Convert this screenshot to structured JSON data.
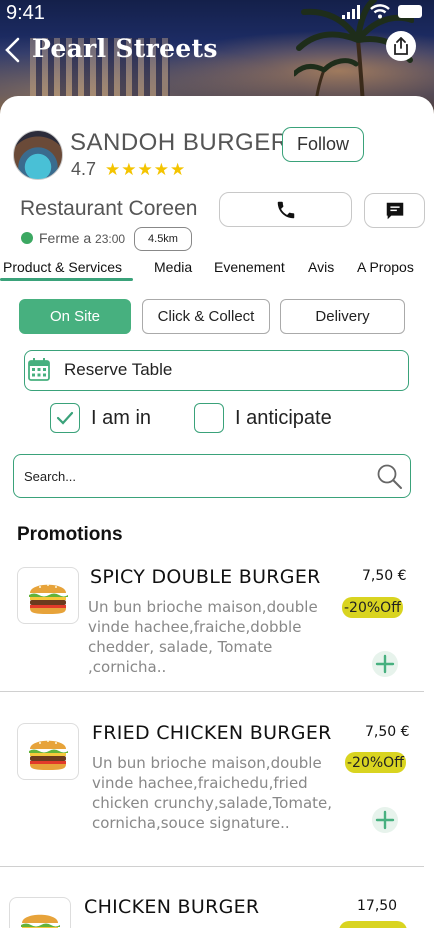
{
  "status": {
    "time": "9:41"
  },
  "header": {
    "title": "Pearl Streets"
  },
  "restaurant": {
    "name": "SANDOH BURGER",
    "rating": "4.7",
    "stars": "★★★★★",
    "follow_label": "Follow",
    "cuisine": "Restaurant Coreen",
    "status_label": "Ferme a",
    "status_time": "23:00",
    "distance": "4.5km"
  },
  "tabs": [
    "Product & Services",
    "Media",
    "Evenement",
    "Avis",
    "A Propos"
  ],
  "modes": {
    "on_site": "On Site",
    "click_collect": "Click & Collect",
    "delivery": "Delivery"
  },
  "reserve": {
    "label": "Reserve Table"
  },
  "options": {
    "i_am_in": "I am in",
    "i_am_in_checked": true,
    "anticipate": "I anticipate",
    "anticipate_checked": false
  },
  "search": {
    "placeholder": "Search..."
  },
  "section": {
    "title": "Promotions"
  },
  "items": [
    {
      "name": "SPICY DOUBLE BURGER",
      "description": "Un bun brioche maison,double vinde hachee,fraiche,dobble chedder, salade, Tomate ,cornicha..",
      "price": "7,50 €",
      "badge": "-20%Off"
    },
    {
      "name": "FRIED CHICKEN BURGER",
      "description": "Un bun brioche maison,double vinde hachee,fraichedu,fried chicken crunchy,salade,Tomate, cornicha,souce signature..",
      "price": "7,50 €",
      "badge": "-20%Off"
    },
    {
      "name": "CHICKEN BURGER",
      "description": "",
      "price": "17,50",
      "badge": ""
    }
  ],
  "colors": {
    "accent": "#3aa27a",
    "accent_fill": "#47b07f",
    "badge": "#d9d420",
    "star": "#f4c400",
    "open": "#3ca862"
  }
}
